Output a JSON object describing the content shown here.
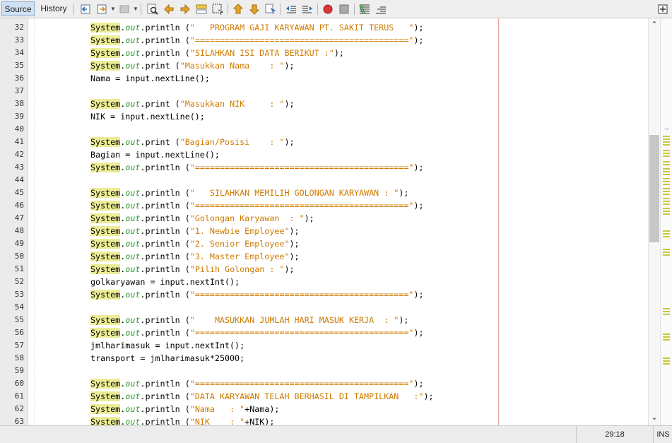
{
  "toolbar": {
    "tabs": [
      {
        "label": "Source",
        "active": true
      },
      {
        "label": "History",
        "active": false
      }
    ],
    "icons": [
      "back-icon",
      "history-dropdown-icon",
      "forward-icon",
      "forward-dropdown-icon",
      "find-selection-icon",
      "find-previous-icon",
      "find-next-icon",
      "toggle-highlight-icon",
      "toggle-rectangular-selection-icon",
      "previous-bookmark-icon",
      "next-bookmark-icon",
      "toggle-bookmark-icon",
      "shift-left-icon",
      "shift-right-icon",
      "start-macro-icon",
      "stop-macro-icon",
      "comment-icon",
      "uncomment-icon"
    ],
    "accent": "#cfe0f3"
  },
  "editor": {
    "colors": {
      "highlight": "#ecec96",
      "field": "#2d9b2d",
      "string": "#ce7b00",
      "margin": "#e8a3a3"
    },
    "lines": [
      {
        "n": "32",
        "t": [
          [
            "System",
            "hl"
          ],
          [
            ".",
            ""
          ],
          [
            "out",
            "fld"
          ],
          [
            ".println (",
            ""
          ],
          [
            "\"   PROGRAM GAJI KARYAWAN PT. SAKIT TERUS   \"",
            "str"
          ],
          [
            ");",
            ""
          ]
        ]
      },
      {
        "n": "33",
        "t": [
          [
            "System",
            "hl"
          ],
          [
            ".",
            ""
          ],
          [
            "out",
            "fld"
          ],
          [
            ".println (",
            ""
          ],
          [
            "\"===========================================\"",
            "str"
          ],
          [
            ");",
            ""
          ]
        ]
      },
      {
        "n": "34",
        "t": [
          [
            "System",
            "hl"
          ],
          [
            ".",
            ""
          ],
          [
            "out",
            "fld"
          ],
          [
            ".println (",
            ""
          ],
          [
            "\"SILAHKAN ISI DATA BERIKUT :\"",
            "str"
          ],
          [
            ");",
            ""
          ]
        ]
      },
      {
        "n": "35",
        "t": [
          [
            "System",
            "hl"
          ],
          [
            ".",
            ""
          ],
          [
            "out",
            "fld"
          ],
          [
            ".print (",
            ""
          ],
          [
            "\"Masukkan Nama    : \"",
            "str"
          ],
          [
            ");",
            ""
          ]
        ]
      },
      {
        "n": "36",
        "t": [
          [
            "Nama = input.nextLine();",
            ""
          ]
        ]
      },
      {
        "n": "37",
        "t": []
      },
      {
        "n": "38",
        "t": [
          [
            "System",
            "hl"
          ],
          [
            ".",
            ""
          ],
          [
            "out",
            "fld"
          ],
          [
            ".print (",
            ""
          ],
          [
            "\"Masukkan NIK     : \"",
            "str"
          ],
          [
            ");",
            ""
          ]
        ]
      },
      {
        "n": "39",
        "t": [
          [
            "NIK = input.nextLine();",
            ""
          ]
        ]
      },
      {
        "n": "40",
        "t": []
      },
      {
        "n": "41",
        "t": [
          [
            "System",
            "hl"
          ],
          [
            ".",
            ""
          ],
          [
            "out",
            "fld"
          ],
          [
            ".print (",
            ""
          ],
          [
            "\"Bagian/Posisi    : \"",
            "str"
          ],
          [
            ");",
            ""
          ]
        ]
      },
      {
        "n": "42",
        "t": [
          [
            "Bagian = input.nextLine();",
            ""
          ]
        ]
      },
      {
        "n": "43",
        "t": [
          [
            "System",
            "hl"
          ],
          [
            ".",
            ""
          ],
          [
            "out",
            "fld"
          ],
          [
            ".println (",
            ""
          ],
          [
            "\"===========================================\"",
            "str"
          ],
          [
            ");",
            ""
          ]
        ]
      },
      {
        "n": "44",
        "t": []
      },
      {
        "n": "45",
        "t": [
          [
            "System",
            "hl"
          ],
          [
            ".",
            ""
          ],
          [
            "out",
            "fld"
          ],
          [
            ".println (",
            ""
          ],
          [
            "\"   SILAHKAN MEMILIH GOLONGAN KARYAWAN : \"",
            "str"
          ],
          [
            ");",
            ""
          ]
        ]
      },
      {
        "n": "46",
        "t": [
          [
            "System",
            "hl"
          ],
          [
            ".",
            ""
          ],
          [
            "out",
            "fld"
          ],
          [
            ".println (",
            ""
          ],
          [
            "\"===========================================\"",
            "str"
          ],
          [
            ");",
            ""
          ]
        ]
      },
      {
        "n": "47",
        "t": [
          [
            "System",
            "hl"
          ],
          [
            ".",
            ""
          ],
          [
            "out",
            "fld"
          ],
          [
            ".println (",
            ""
          ],
          [
            "\"Golongan Karyawan  : \"",
            "str"
          ],
          [
            ");",
            ""
          ]
        ]
      },
      {
        "n": "48",
        "t": [
          [
            "System",
            "hl"
          ],
          [
            ".",
            ""
          ],
          [
            "out",
            "fld"
          ],
          [
            ".println (",
            ""
          ],
          [
            "\"1. Newbie Employee\"",
            "str"
          ],
          [
            ");",
            ""
          ]
        ]
      },
      {
        "n": "49",
        "t": [
          [
            "System",
            "hl"
          ],
          [
            ".",
            ""
          ],
          [
            "out",
            "fld"
          ],
          [
            ".println (",
            ""
          ],
          [
            "\"2. Senior Employee\"",
            "str"
          ],
          [
            ");",
            ""
          ]
        ]
      },
      {
        "n": "50",
        "t": [
          [
            "System",
            "hl"
          ],
          [
            ".",
            ""
          ],
          [
            "out",
            "fld"
          ],
          [
            ".println (",
            ""
          ],
          [
            "\"3. Master Employee\"",
            "str"
          ],
          [
            ");",
            ""
          ]
        ]
      },
      {
        "n": "51",
        "t": [
          [
            "System",
            "hl"
          ],
          [
            ".",
            ""
          ],
          [
            "out",
            "fld"
          ],
          [
            ".println (",
            ""
          ],
          [
            "\"Pilih Golongan : \"",
            "str"
          ],
          [
            ");",
            ""
          ]
        ]
      },
      {
        "n": "52",
        "t": [
          [
            "golkaryawan = input.nextInt();",
            ""
          ]
        ]
      },
      {
        "n": "53",
        "t": [
          [
            "System",
            "hl"
          ],
          [
            ".",
            ""
          ],
          [
            "out",
            "fld"
          ],
          [
            ".println (",
            ""
          ],
          [
            "\"===========================================\"",
            "str"
          ],
          [
            ");",
            ""
          ]
        ]
      },
      {
        "n": "54",
        "t": []
      },
      {
        "n": "55",
        "t": [
          [
            "System",
            "hl"
          ],
          [
            ".",
            ""
          ],
          [
            "out",
            "fld"
          ],
          [
            ".println (",
            ""
          ],
          [
            "\"    MASUKKAN JUMLAH HARI MASUK KERJA  : \"",
            "str"
          ],
          [
            ");",
            ""
          ]
        ]
      },
      {
        "n": "56",
        "t": [
          [
            "System",
            "hl"
          ],
          [
            ".",
            ""
          ],
          [
            "out",
            "fld"
          ],
          [
            ".println (",
            ""
          ],
          [
            "\"===========================================\"",
            "str"
          ],
          [
            ");",
            ""
          ]
        ]
      },
      {
        "n": "57",
        "t": [
          [
            "jmlharimasuk = input.nextInt();",
            ""
          ]
        ]
      },
      {
        "n": "58",
        "t": [
          [
            "transport = jmlharimasuk*25000;",
            ""
          ]
        ]
      },
      {
        "n": "59",
        "t": []
      },
      {
        "n": "60",
        "t": [
          [
            "System",
            "hl"
          ],
          [
            ".",
            ""
          ],
          [
            "out",
            "fld"
          ],
          [
            ".println (",
            ""
          ],
          [
            "\"===========================================\"",
            "str"
          ],
          [
            ");",
            ""
          ]
        ]
      },
      {
        "n": "61",
        "t": [
          [
            "System",
            "hl"
          ],
          [
            ".",
            ""
          ],
          [
            "out",
            "fld"
          ],
          [
            ".println (",
            ""
          ],
          [
            "\"DATA KARYAWAN TELAH BERHASIL DI TAMPILKAN   :\"",
            "str"
          ],
          [
            ");",
            ""
          ]
        ]
      },
      {
        "n": "62",
        "t": [
          [
            "System",
            "hl"
          ],
          [
            ".",
            ""
          ],
          [
            "out",
            "fld"
          ],
          [
            ".println (",
            ""
          ],
          [
            "\"Nama   : \"",
            "str"
          ],
          [
            "+Nama);",
            ""
          ]
        ]
      },
      {
        "n": "63",
        "t": [
          [
            "System",
            "hl"
          ],
          [
            ".",
            ""
          ],
          [
            "out",
            "fld"
          ],
          [
            ".println (",
            ""
          ],
          [
            "\"NIK    : \"",
            "str"
          ],
          [
            "+NIK);",
            ""
          ]
        ]
      }
    ]
  },
  "status": {
    "position": "29:18",
    "mode": "INS"
  },
  "scrollbar": {
    "position_fraction": 0.3
  }
}
